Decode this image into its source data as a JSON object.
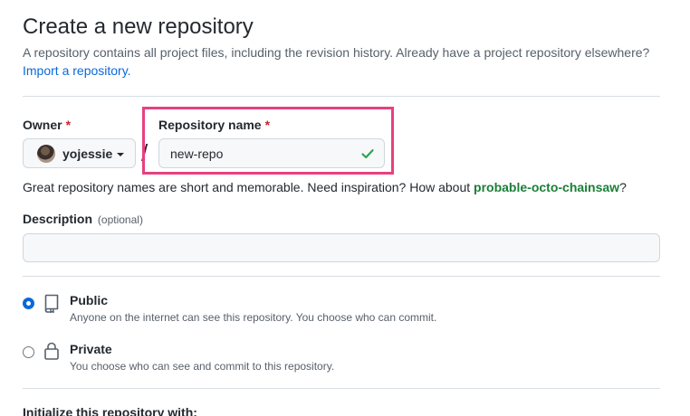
{
  "header": {
    "title": "Create a new repository",
    "subtitle": "A repository contains all project files, including the revision history. Already have a project repository elsewhere?",
    "import_link": "Import a repository."
  },
  "owner": {
    "label": "Owner",
    "required_mark": "*",
    "selected": "yojessie"
  },
  "separator": "/",
  "repo_name": {
    "label": "Repository name",
    "required_mark": "*",
    "value": "new-repo",
    "valid": true
  },
  "hint": {
    "text": "Great repository names are short and memorable. Need inspiration? How about",
    "suggestion": "probable-octo-chainsaw",
    "suffix": "?"
  },
  "description": {
    "label": "Description",
    "optional": "(optional)",
    "value": ""
  },
  "visibility": {
    "selected": "public",
    "options": [
      {
        "id": "public",
        "title": "Public",
        "description": "Anyone on the internet can see this repository. You choose who can commit.",
        "icon": "repo-icon"
      },
      {
        "id": "private",
        "title": "Private",
        "description": "You choose who can see and commit to this repository.",
        "icon": "lock-icon"
      }
    ]
  },
  "initialize": {
    "title": "Initialize this repository with:"
  },
  "colors": {
    "accent": "#0969da",
    "highlight_border": "#e8407f",
    "success": "#1a7f37",
    "required": "#cf222e"
  }
}
